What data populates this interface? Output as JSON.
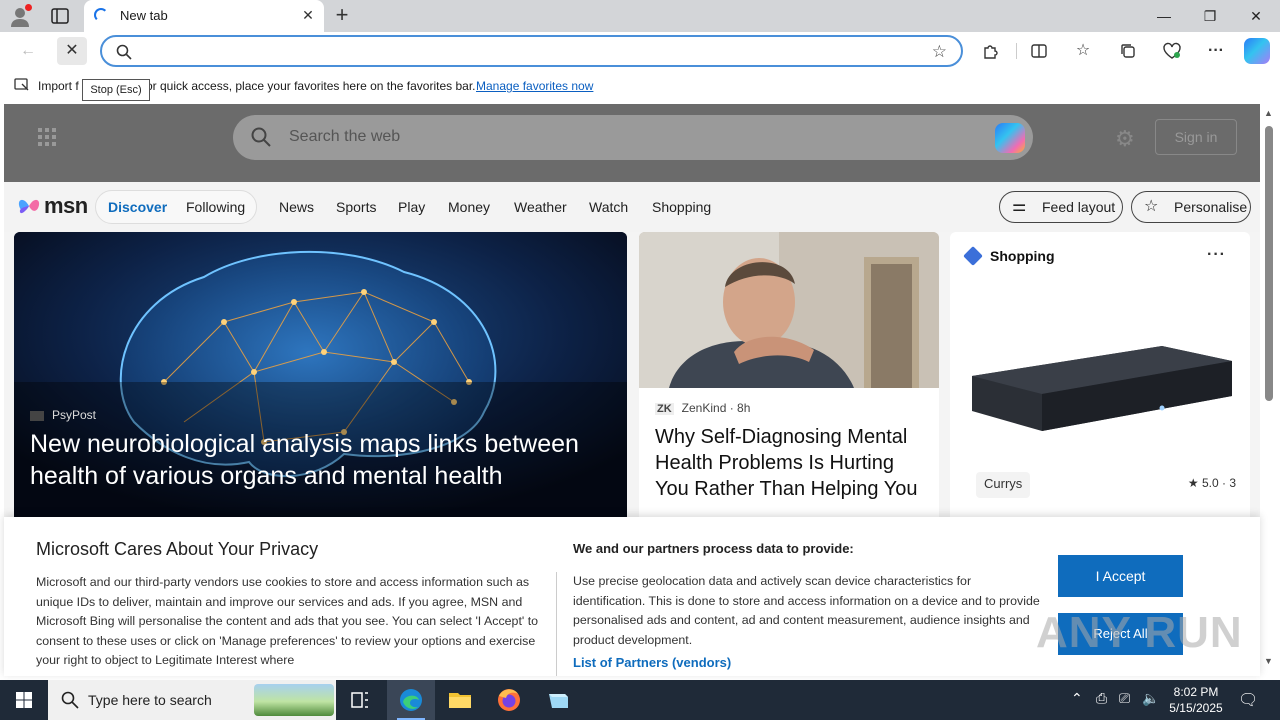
{
  "browser": {
    "tab_title": "New tab",
    "address_value": "",
    "tooltip": "Stop (Esc)",
    "favorites_bar": {
      "import_text": "Import f",
      "message": "or quick access, place your favorites here on the favorites bar.",
      "manage_link": "Manage favorites now"
    }
  },
  "msn": {
    "search_placeholder": "Search the web",
    "sign_in": "Sign in",
    "logo_text": "msn",
    "pill": {
      "discover": "Discover",
      "following": "Following"
    },
    "nav": [
      "News",
      "Sports",
      "Play",
      "Money",
      "Weather",
      "Watch",
      "Shopping"
    ],
    "feed_layout": "Feed layout",
    "personalise": "Personalise",
    "cards": {
      "main": {
        "source": "PsyPost",
        "headline": "New neurobiological analysis maps links between health of various organs and mental health"
      },
      "mid": {
        "source_badge": "ZK",
        "source": "ZenKind · 8h",
        "headline": "Why Self-Diagnosing Mental Health Problems Is Hurting You Rather Than Helping You"
      },
      "shop": {
        "title": "Shopping",
        "more": "···",
        "store": "Currys",
        "rating": "5.0 · 3"
      }
    }
  },
  "privacy": {
    "title": "Microsoft Cares About Your Privacy",
    "body": "Microsoft and our third-party vendors use cookies to store and access information such as unique IDs to deliver, maintain and improve our services and ads. If you agree, MSN and Microsoft Bing will personalise the content and ads that you see. You can select 'I Accept' to consent to these uses or click on 'Manage preferences' to review your options and exercise your right to object to Legitimate Interest where",
    "subtitle": "We and our partners process data to provide:",
    "body2": "Use precise geolocation data and actively scan device characteristics for identification. This is done to store and access information on a device and to provide personalised ads and content, ad and content measurement, audience insights and product development.",
    "partners_link": "List of Partners (vendors)",
    "accept": "I Accept",
    "reject": "Reject All"
  },
  "watermark": "ANY RUN",
  "taskbar": {
    "search_text": "Type here to search",
    "time": "8:02 PM",
    "date": "5/15/2025"
  },
  "colors": {
    "accent": "#0f6cbd",
    "taskbar": "#1f2a38"
  }
}
